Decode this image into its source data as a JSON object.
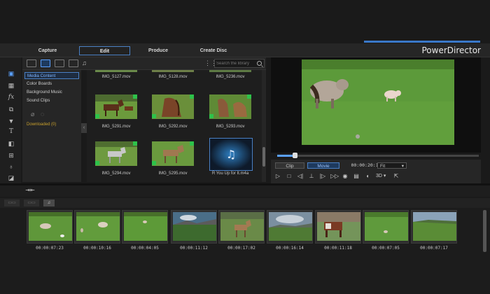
{
  "brand": "PowerDirector",
  "modes": [
    {
      "label": "Capture",
      "active": false
    },
    {
      "label": "Edit",
      "active": true
    },
    {
      "label": "Produce",
      "active": false
    },
    {
      "label": "Create Disc",
      "active": false
    }
  ],
  "library": {
    "search_placeholder": "Search the library",
    "categories": [
      "Media Content",
      "Color Boards",
      "Background Music",
      "Sound Clips"
    ],
    "downloaded_label": "Downloaded  (0)",
    "top_row_labels": [
      "IMG_5127.mov",
      "IMG_5128.mov",
      "IMG_5236.mov"
    ],
    "items": [
      {
        "label": "IMG_5291.mov"
      },
      {
        "label": "IMG_5292.mov"
      },
      {
        "label": "IMG_5293.mov"
      },
      {
        "label": "IMG_5294.mov"
      },
      {
        "label": "IMG_5295.mov"
      },
      {
        "label": "R You Up for It.m4a"
      }
    ]
  },
  "preview": {
    "clip_label": "Clip",
    "movie_label": "Movie",
    "timecode": "00:00:20:19",
    "fit_label": "Fit",
    "label_3d": "3D",
    "progress": 0.08
  },
  "timeline": {
    "clips": [
      {
        "duration": "00:00:07:23"
      },
      {
        "duration": "00:00:10:16"
      },
      {
        "duration": "00:00:04:05"
      },
      {
        "duration": "00:00:11:12"
      },
      {
        "duration": "00:00:17:02"
      },
      {
        "duration": "00:00:16:14"
      },
      {
        "duration": "00:00:11:18"
      },
      {
        "duration": "00:00:07:05"
      },
      {
        "duration": "00:00:07:17"
      }
    ]
  },
  "colors": {
    "accent": "#4a80c4",
    "grass": "#5c9a3a",
    "check": "#2ec24a"
  }
}
